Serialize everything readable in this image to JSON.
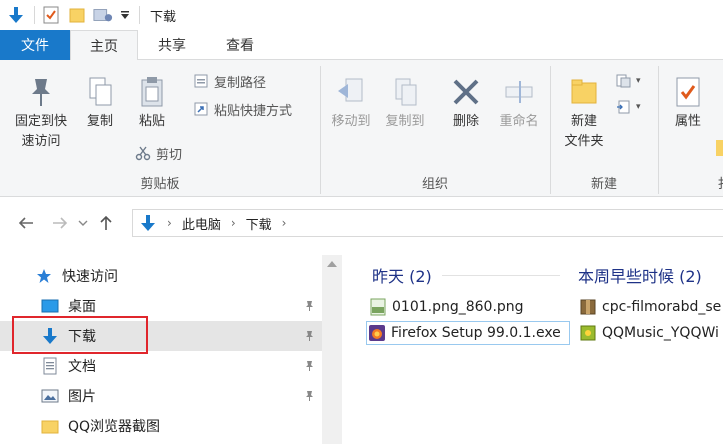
{
  "window": {
    "title": "下载"
  },
  "tabs": [
    "文件",
    "主页",
    "共享",
    "查看"
  ],
  "ribbon": {
    "clipboard": {
      "pin_label_1": "固定到快",
      "pin_label_2": "速访问",
      "copy": "复制",
      "paste": "粘贴",
      "copy_path": "复制路径",
      "paste_shortcut": "粘贴快捷方式",
      "cut": "剪切",
      "group": "剪贴板"
    },
    "organize": {
      "move_to": "移动到",
      "copy_to": "复制到",
      "delete": "删除",
      "rename": "重命名",
      "group": "组织"
    },
    "new": {
      "new_folder_1": "新建",
      "new_folder_2": "文件夹",
      "group": "新建"
    },
    "open": {
      "properties": "属性",
      "group_partial": "扌"
    }
  },
  "address": {
    "crumbs": [
      "此电脑",
      "下载"
    ]
  },
  "nav": {
    "quick_access": "快速访问",
    "items": [
      {
        "label": "桌面",
        "pinned": true
      },
      {
        "label": "下载",
        "pinned": true
      },
      {
        "label": "文档",
        "pinned": true
      },
      {
        "label": "图片",
        "pinned": true
      },
      {
        "label": "QQ浏览器截图",
        "pinned": false
      }
    ]
  },
  "content": {
    "groups": [
      {
        "heading": "昨天 (2)",
        "files": [
          "0101.png_860.png",
          "Firefox Setup 99.0.1.exe"
        ]
      },
      {
        "heading": "本周早些时候 (2)",
        "files": [
          "cpc-filmorabd_se",
          "QQMusic_YQQWi"
        ]
      }
    ]
  },
  "colors": {
    "accent": "#1979ca",
    "group_heading": "#1e3287",
    "highlight": "#e0262c"
  }
}
